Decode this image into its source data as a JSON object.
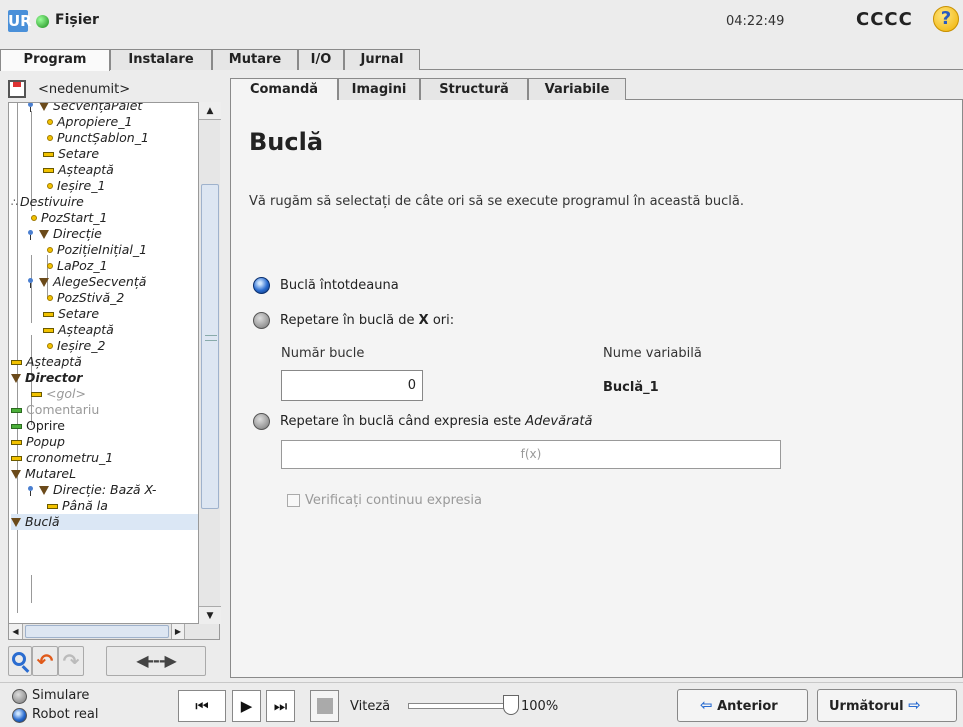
{
  "topbar": {
    "logo_text": "UR",
    "file_menu": "Fișier",
    "clock": "04:22:49",
    "robot_name": "CCCC",
    "help_glyph": "?"
  },
  "main_tabs": [
    {
      "label": "Program",
      "active": true
    },
    {
      "label": "Instalare",
      "active": false
    },
    {
      "label": "Mutare",
      "active": false
    },
    {
      "label": "I/O",
      "active": false
    },
    {
      "label": "Jurnal",
      "active": false
    }
  ],
  "program": {
    "name": "<nedenumit>"
  },
  "tree": {
    "nodes": [
      {
        "label": "SecvențaPalet",
        "icon": "triangle-icon"
      },
      {
        "label": "Apropiere_1",
        "icon": "waypoint-icon"
      },
      {
        "label": "PunctȘablon_1",
        "icon": "waypoint-icon"
      },
      {
        "label": "Setare",
        "icon": "action-bar-icon"
      },
      {
        "label": "Așteaptă",
        "icon": "action-bar-icon"
      },
      {
        "label": "Ieșire_1",
        "icon": "waypoint-icon"
      },
      {
        "label": "Destivuire",
        "icon": "destack-icon"
      },
      {
        "label": "PozStart_1",
        "icon": "waypoint-icon"
      },
      {
        "label": "Direcție",
        "icon": "triangle-icon"
      },
      {
        "label": "PozițieInițial_1",
        "icon": "waypoint-icon"
      },
      {
        "label": "LaPoz_1",
        "icon": "waypoint-icon"
      },
      {
        "label": "AlegeSecvență",
        "icon": "triangle-icon"
      },
      {
        "label": "PozStivă_2",
        "icon": "waypoint-icon"
      },
      {
        "label": "Setare",
        "icon": "action-bar-icon"
      },
      {
        "label": "Așteaptă",
        "icon": "action-bar-icon"
      },
      {
        "label": "Ieșire_2",
        "icon": "waypoint-icon"
      },
      {
        "label": "Așteaptă",
        "icon": "action-bar-icon"
      },
      {
        "label": "Director",
        "icon": "triangle-icon"
      },
      {
        "label": "<gol>",
        "icon": "action-bar-icon"
      },
      {
        "label": "Comentariu",
        "icon": "comment-bar-icon"
      },
      {
        "label": "Oprire",
        "icon": "stop-bar-icon"
      },
      {
        "label": "Popup",
        "icon": "action-bar-icon"
      },
      {
        "label": "cronometru_1",
        "icon": "action-bar-icon"
      },
      {
        "label": "MutareL",
        "icon": "triangle-icon"
      },
      {
        "label": "Direcție: Bază X-",
        "icon": "triangle-icon"
      },
      {
        "label": "Până la",
        "icon": "action-bar-icon"
      },
      {
        "label": "Buclă",
        "icon": "triangle-icon"
      }
    ]
  },
  "tools": {
    "search": "search-icon",
    "undo": "undo-icon",
    "redo": "redo-icon",
    "move": "move-icon",
    "move_glyph": "◀---▶",
    "undo_glyph": "↶",
    "redo_glyph": "↷"
  },
  "sub_tabs": [
    {
      "label": "Comandă",
      "active": true
    },
    {
      "label": "Imagini",
      "active": false
    },
    {
      "label": "Structură",
      "active": false
    },
    {
      "label": "Variabile",
      "active": false
    }
  ],
  "loop": {
    "title": "Buclă",
    "instructions": "Vă rugăm să selectați de câte ori să se execute programul în această buclă.",
    "option_always": "Buclă întotdeauna",
    "option_times_prefix": "Repetare în buclă de ",
    "option_times_x": "X",
    "option_times_suffix": " ori:",
    "count_label": "Număr bucle",
    "count_value": "0",
    "varname_label": "Nume variabilă",
    "varname_value": "Buclă_1",
    "option_expr_prefix": "Repetare în buclă când expresia este ",
    "option_expr_value": "Adevărată",
    "expr_placeholder": "f(x)",
    "check_label": "Verificați continuu expresia",
    "selected_option": "always"
  },
  "bottom": {
    "mode_sim": "Simulare",
    "mode_real": "Robot real",
    "selected_mode": "real",
    "speed_label": "Viteză",
    "speed_value": "100%",
    "speed_fraction": 1.0,
    "prev_label": "Anterior",
    "next_label": "Următorul",
    "prev_glyph": "⇦",
    "next_glyph": "⇨"
  },
  "colors": {
    "accent": "#2a6cd0",
    "run_indicator": "#1a8a1a",
    "help": "#f0b000"
  }
}
